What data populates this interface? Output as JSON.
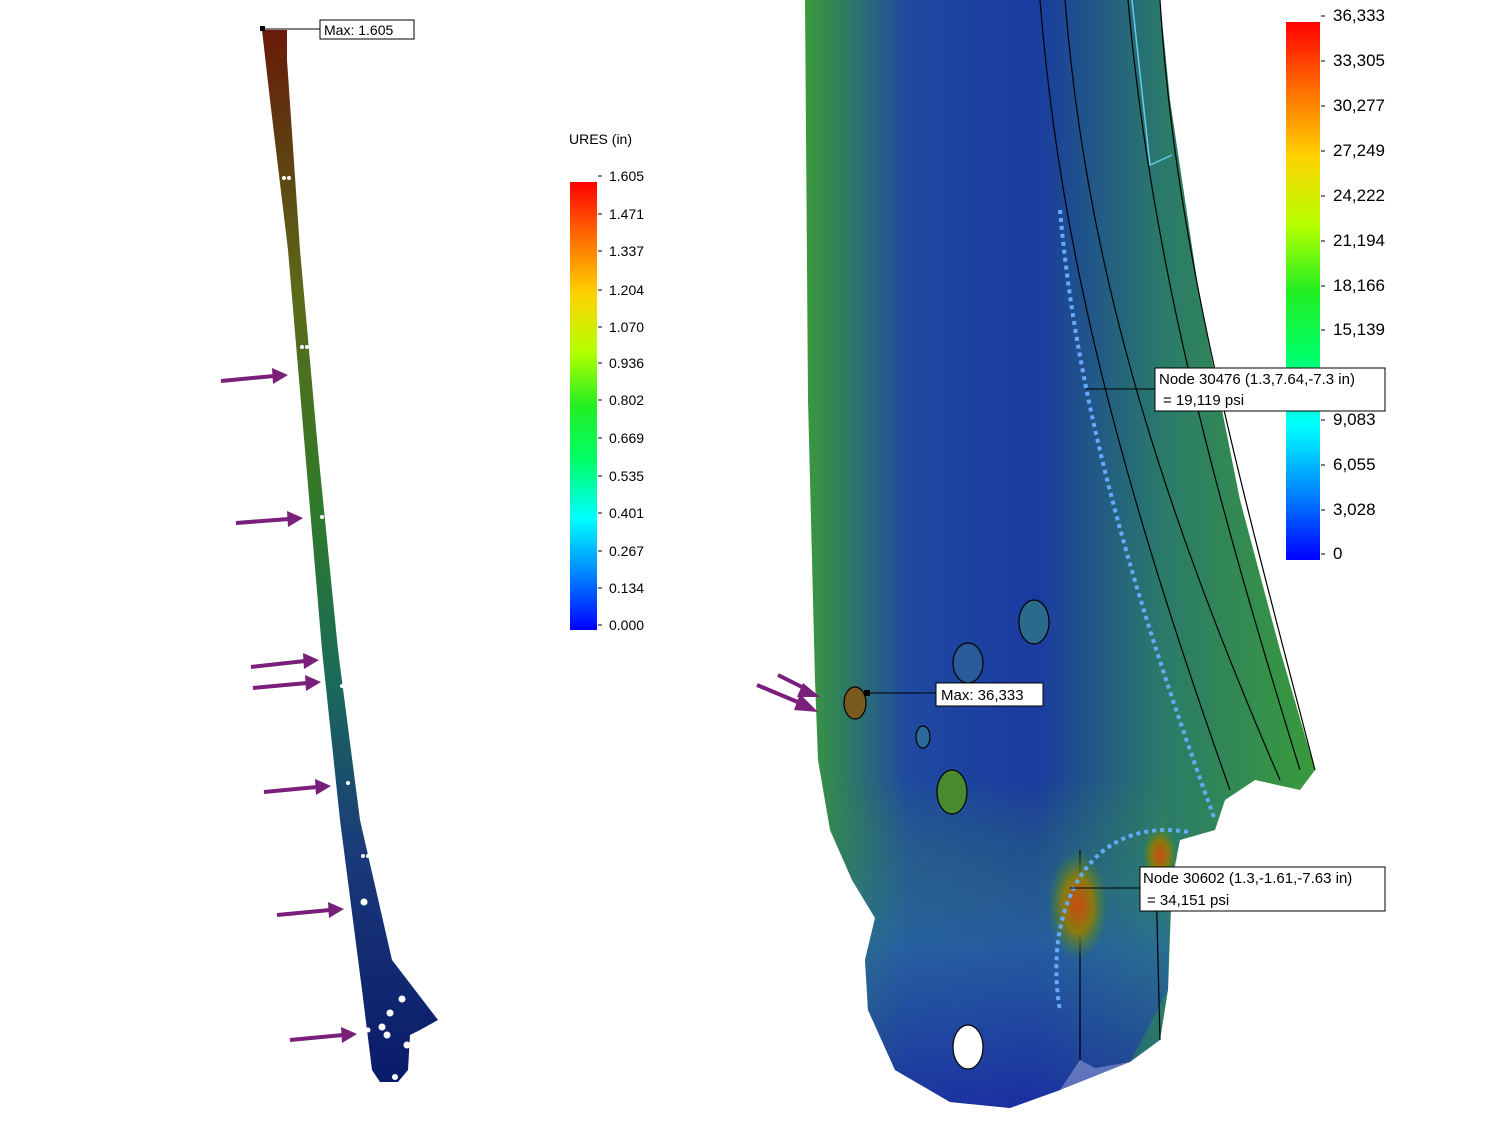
{
  "displacement_plot": {
    "legend_title": "URES (in)",
    "legend_ticks": [
      "1.605",
      "1.471",
      "1.337",
      "1.204",
      "1.070",
      "0.936",
      "0.802",
      "0.669",
      "0.535",
      "0.401",
      "0.267",
      "0.134",
      "0.000"
    ],
    "max_label": "Max: 1.605"
  },
  "stress_plot": {
    "legend_ticks": [
      "36,333",
      "33,305",
      "30,277",
      "27,249",
      "24,222",
      "21,194",
      "18,166",
      "15,139",
      "9,083",
      "6,055",
      "3,028",
      "0"
    ],
    "max_label": "Max: 36,333",
    "probe_1": {
      "line1": "Node 30476 (1.3,7.64,-7.3 in)",
      "line2": "= 19,119   psi"
    },
    "probe_2": {
      "line1": "Node 30602 (1.3,-1.61,-7.63 in)",
      "line2": "= 34,151   psi"
    }
  },
  "colors": {
    "load_arrow": "#7a1f7a",
    "contour_max": "#ff0000",
    "contour_min": "#0000ff",
    "probe_path": "#66aaff"
  }
}
